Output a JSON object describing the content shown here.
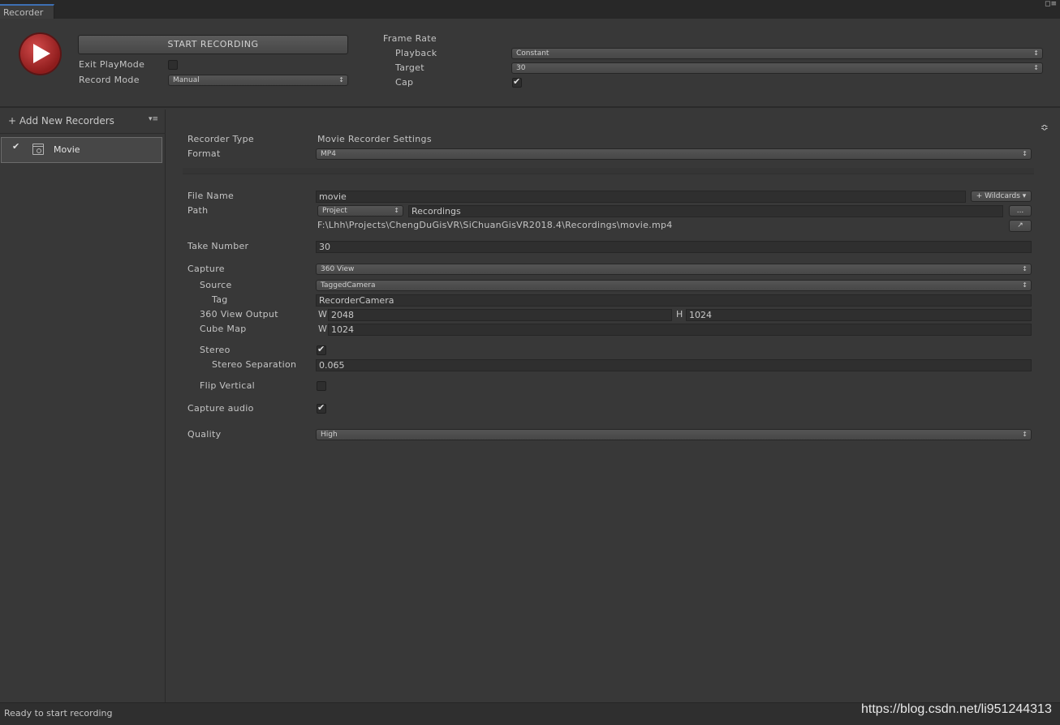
{
  "window": {
    "tab_title": "Recorder",
    "menu_glyph": "◻≡"
  },
  "header": {
    "start_recording_label": "START RECORDING",
    "exit_playmode_label": "Exit PlayMode",
    "exit_playmode_checked": false,
    "record_mode_label": "Record Mode",
    "record_mode_value": "Manual",
    "frame_rate_label": "Frame Rate",
    "playback_label": "Playback",
    "playback_value": "Constant",
    "target_label": "Target",
    "target_value": "30",
    "cap_label": "Cap",
    "cap_checked": true
  },
  "sidebar": {
    "add_new_label": "+ Add New Recorders",
    "menu_glyph": "▾≡",
    "items": [
      {
        "label": "Movie",
        "enabled": true
      }
    ]
  },
  "settings": {
    "recorder_type_label": "Recorder Type",
    "recorder_type_value": "Movie Recorder Settings",
    "format_label": "Format",
    "format_value": "MP4",
    "file_name_label": "File Name",
    "file_name_value": "movie",
    "wildcards_label": "+ Wildcards ▾",
    "path_label": "Path",
    "path_root_value": "Project",
    "path_value": "Recordings",
    "browse_label": "...",
    "full_path": "F:\\Lhh\\Projects\\ChengDuGisVR\\SiChuanGisVR2018.4\\Recordings\\movie.mp4",
    "take_number_label": "Take Number",
    "take_number_value": "30",
    "capture_label": "Capture",
    "capture_value": "360 View",
    "source_label": "Source",
    "source_value": "TaggedCamera",
    "tag_label": "Tag",
    "tag_value": "RecorderCamera",
    "view_output_label": "360 View Output",
    "w_label": "W",
    "h_label": "H",
    "view_output_w": "2048",
    "view_output_h": "1024",
    "cube_map_label": "Cube Map",
    "cube_map_w": "1024",
    "stereo_label": "Stereo",
    "stereo_checked": true,
    "stereo_separation_label": "Stereo Separation",
    "stereo_separation_value": "0.065",
    "flip_vertical_label": "Flip Vertical",
    "flip_vertical_checked": false,
    "capture_audio_label": "Capture audio",
    "capture_audio_checked": true,
    "quality_label": "Quality",
    "quality_value": "High",
    "dropdown_arrow": "↕"
  },
  "status": {
    "text": "Ready to start recording",
    "watermark": "https://blog.csdn.net/li951244313"
  },
  "colors": {
    "background": "#383838",
    "record_red": "#b32c2c",
    "tab_accent": "#3d6fb3"
  }
}
